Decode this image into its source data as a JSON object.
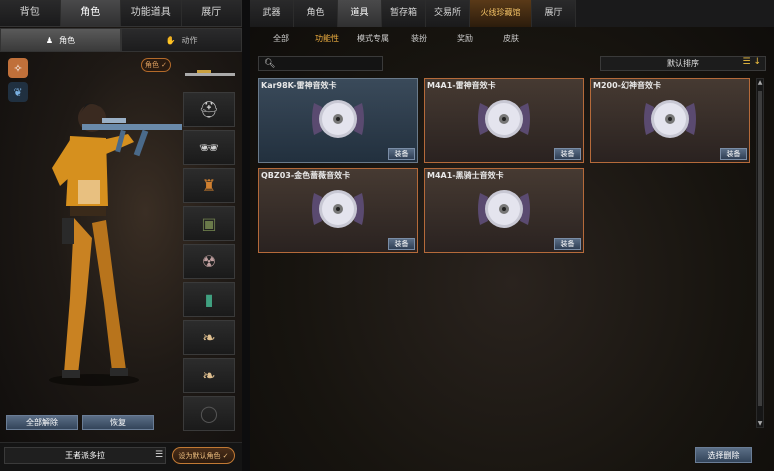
{
  "left_panel": {
    "top_tabs": [
      "背包",
      "角色",
      "功能道具",
      "展厅"
    ],
    "active_top_tab": 1,
    "sub_tabs": [
      {
        "label": "角色",
        "icon": "character-icon"
      },
      {
        "label": "动作",
        "icon": "hand-icon"
      }
    ],
    "role_chip": "角色 ✓",
    "buttons": {
      "unequip_all": "全部解除",
      "restore": "恢复"
    },
    "character_name": "王者派多拉",
    "default_role_button": "设为默认角色 ✓"
  },
  "slot_icons": [
    "rifle-icon",
    "helmet-icon",
    "goggles-icon",
    "figurine-icon",
    "backpack-icon",
    "mask-icon",
    "card-icon",
    "wing-icon",
    "wing-icon",
    "empty-slot-icon"
  ],
  "right_panel": {
    "main_tabs": [
      "武器",
      "角色",
      "道具",
      "暂存箱",
      "交易所",
      "火线珍藏馆",
      "展厅"
    ],
    "active_main_tab": 2,
    "sub_tabs": [
      "全部",
      "功能性",
      "模式专属",
      "装扮",
      "奖励",
      "皮肤"
    ],
    "active_sub_tab": 1,
    "search_placeholder": "",
    "sort_label": "默认排序",
    "sort_icons": "☰ ↓",
    "cards": [
      {
        "title": "Kar98K-雷神音效卡",
        "equip": "装备",
        "selected": true
      },
      {
        "title": "M4A1-雷神音效卡",
        "equip": "装备",
        "selected": false
      },
      {
        "title": "M200-幻神音效卡",
        "equip": "装备",
        "selected": false
      },
      {
        "title": "QBZ03-金色蔷薇音效卡",
        "equip": "装备",
        "selected": false
      },
      {
        "title": "M4A1-黑骑士音效卡",
        "equip": "装备",
        "selected": false
      }
    ],
    "select_delete": "选择删除"
  },
  "colors": {
    "accent": "#f0b040",
    "card_border": "#b56a3a",
    "button": "#4a5d76"
  }
}
